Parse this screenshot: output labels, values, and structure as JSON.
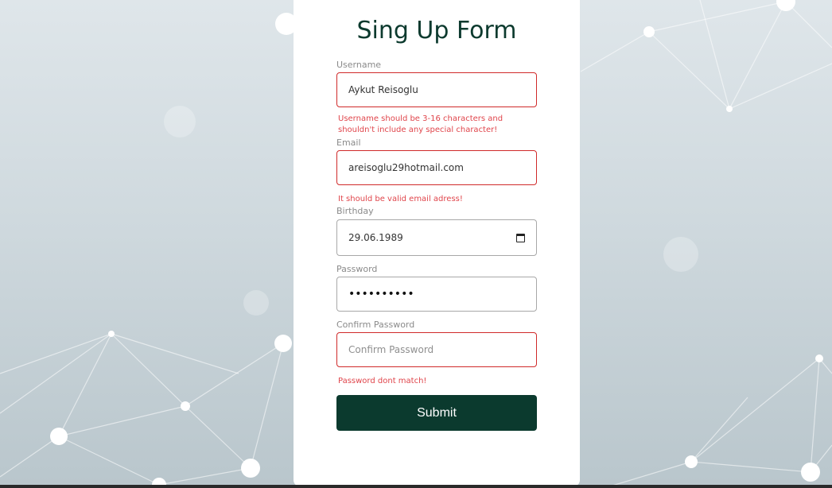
{
  "form": {
    "title": "Sing Up Form",
    "username": {
      "label": "Username",
      "value": "Aykut Reisoglu",
      "error_line1": "Username should be 3-16 characters and",
      "error_line2": "shouldn't include any special character!"
    },
    "email": {
      "label": "Email",
      "value": "areisoglu29hotmail.com",
      "error": "It should be valid email adress!"
    },
    "birthday": {
      "label": "Birthday",
      "value": "29.06.1989",
      "icon": "calendar-icon"
    },
    "password": {
      "label": "Password",
      "value": "••••••••••"
    },
    "confirm_password": {
      "label": "Confirm Password",
      "placeholder": "Confirm Password",
      "error": "Password dont match!"
    },
    "submit_label": "Submit"
  },
  "colors": {
    "accent": "#0b3a2e",
    "error": "#e0454b",
    "invalid_border": "#d02a2a"
  }
}
